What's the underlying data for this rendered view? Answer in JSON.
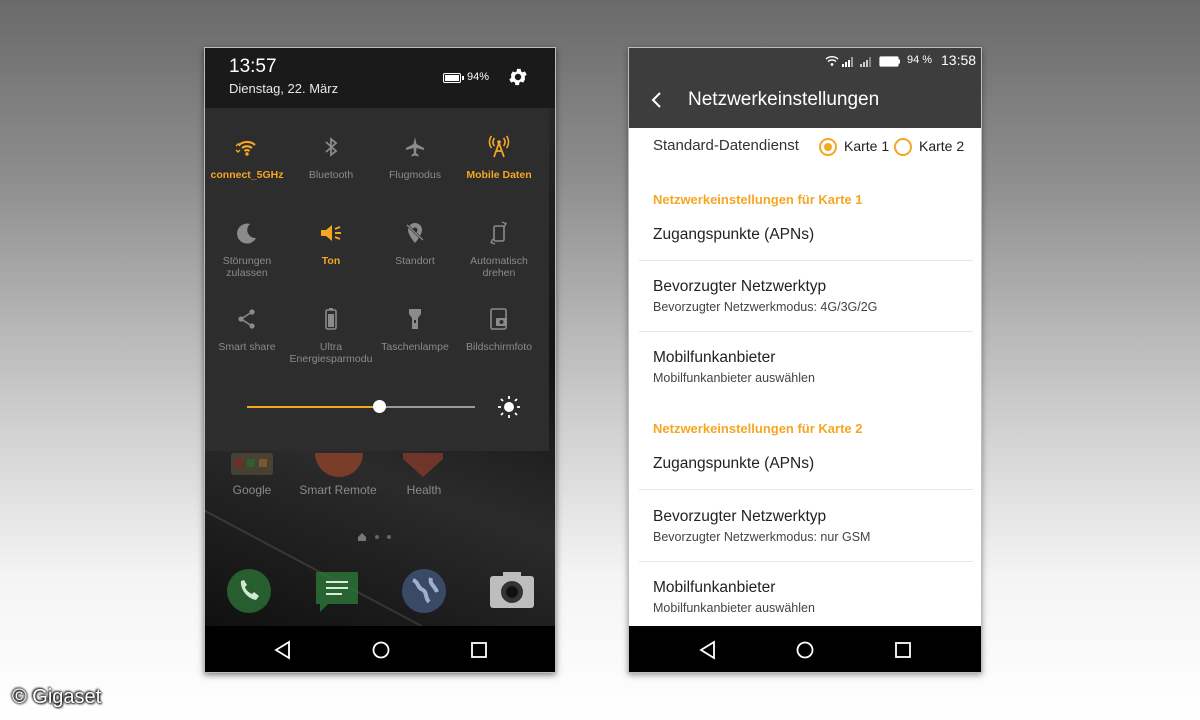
{
  "left_phone": {
    "status": {
      "time": "13:57",
      "date": "Dienstag, 22. März",
      "battery": "94%"
    },
    "quick_settings": [
      {
        "label": "connect_5GHz",
        "icon": "wifi-icon",
        "active": true
      },
      {
        "label": "Bluetooth",
        "icon": "bluetooth-icon",
        "active": false
      },
      {
        "label": "Flugmodus",
        "icon": "airplane-icon",
        "active": false
      },
      {
        "label": "Mobile Daten",
        "icon": "mobile-data-icon",
        "active": true
      },
      {
        "label": "Störungen zulassen",
        "icon": "moon-icon",
        "active": false
      },
      {
        "label": "Ton",
        "icon": "volume-icon",
        "active": true
      },
      {
        "label": "Standort",
        "icon": "location-off-icon",
        "active": false
      },
      {
        "label": "Automatisch drehen",
        "icon": "auto-rotate-icon",
        "active": false
      },
      {
        "label": "Smart share",
        "icon": "share-icon",
        "active": false
      },
      {
        "label": "Ultra Energiesparmodu",
        "icon": "battery-saver-icon",
        "active": false
      },
      {
        "label": "Taschenlampe",
        "icon": "flashlight-icon",
        "active": false
      },
      {
        "label": "Bildschirmfoto",
        "icon": "screenshot-icon",
        "active": false
      }
    ],
    "brightness": 0.58,
    "home_apps": [
      "Google",
      "Smart Remote",
      "Health"
    ],
    "accent_color": "#f5a623"
  },
  "right_phone": {
    "status": {
      "battery": "94 %",
      "time": "13:58"
    },
    "title": "Netzwerkeinstellungen",
    "standard": {
      "label": "Standard-Datendienst",
      "options": [
        "Karte 1",
        "Karte 2"
      ],
      "selected": "Karte 1"
    },
    "sections": [
      {
        "header": "Netzwerkeinstellungen für Karte 1",
        "items": [
          {
            "title": "Zugangspunkte (APNs)",
            "subtitle": ""
          },
          {
            "title": "Bevorzugter Netzwerktyp",
            "subtitle": "Bevorzugter Netzwerkmodus: 4G/3G/2G"
          },
          {
            "title": "Mobilfunkanbieter",
            "subtitle": "Mobilfunkanbieter auswählen"
          }
        ]
      },
      {
        "header": "Netzwerkeinstellungen für Karte 2",
        "items": [
          {
            "title": "Zugangspunkte (APNs)",
            "subtitle": ""
          },
          {
            "title": "Bevorzugter Netzwerktyp",
            "subtitle": "Bevorzugter Netzwerkmodus: nur GSM"
          },
          {
            "title": "Mobilfunkanbieter",
            "subtitle": "Mobilfunkanbieter auswählen"
          }
        ]
      }
    ]
  },
  "copyright": "© Gigaset"
}
